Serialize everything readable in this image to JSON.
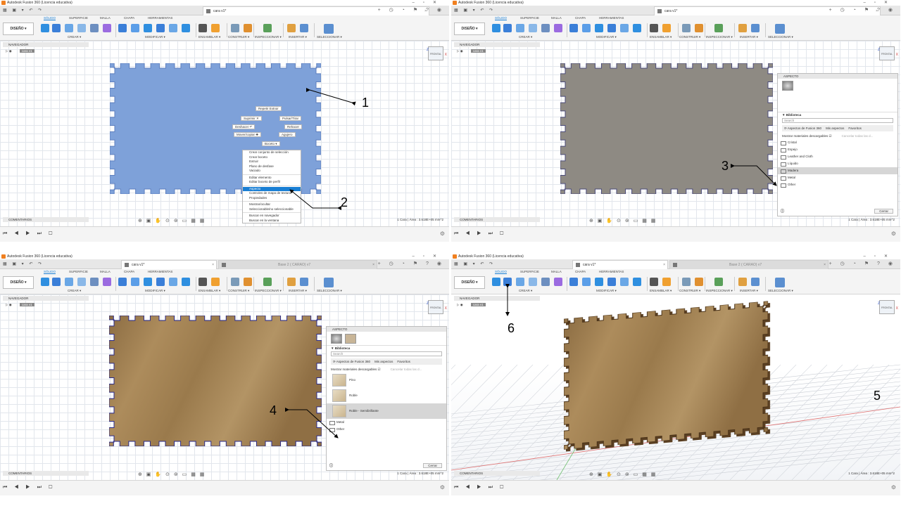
{
  "app": {
    "title": "Autodesk Fusion 360 (Licencia educativa)",
    "workspace": "DISEÑO",
    "ribbon_tabs": [
      "SÓLIDO",
      "SUPERFICIE",
      "MALLA",
      "CHAPA",
      "HERRAMIENTAS"
    ],
    "groups": [
      "CREAR",
      "MODIFICAR",
      "ENSAMBLAR",
      "CONSTRUIR",
      "INSPECCIONAR",
      "INSERTAR",
      "SELECCIONAR"
    ],
    "navigator": "NAVEGADOR",
    "component": "cara v1",
    "comments": "COMENTARIOS",
    "status": "1 Cara | Área : 3.618E+05 mm^2",
    "doc_tab": "cara v1*",
    "doc_tab2": "Base 2 ( CARAO) v7",
    "viewcube": "FRONTAL",
    "axis_z": "Z",
    "axis_x": "X"
  },
  "marking_menu": {
    "repeat": "Repetir Extruir",
    "delete": "Suprimir",
    "press_pull": "Pulsar/Tirar",
    "undo": "Deshacer",
    "redo": "Rehacer",
    "move_copy": "Mover/copiar",
    "holes": "Agujero",
    "sketch": "Boceto"
  },
  "context_menu": [
    "Crear conjunto de selección",
    "Crear boceto",
    "Extruir",
    "Plano de desfase",
    "Vaciado",
    "Editar elemento",
    "Editar boceto de perfil",
    "Aspecto",
    "Controles de mapa de textura",
    "Propiedades",
    "Mostrar/ocultar",
    "Seleccionable/no seleccionable",
    "Buscar en navegador",
    "Buscar en la ventana"
  ],
  "appearance_panel": {
    "title": "ASPECTO",
    "library": "Biblioteca",
    "search": "Search",
    "lib_fusion": "Aspectos de Fusion 360",
    "lib_mine": "Mis aspectos",
    "lib_fav": "Favoritos",
    "show_downloadable": "Mostrar materiales descargables",
    "cancel_all": "Cancelar todas las d...",
    "folders": [
      "Cristal",
      "Espejo",
      "Leather and Cloth",
      "Líquido",
      "Madera",
      "Metal",
      "Other"
    ],
    "wood_items": [
      "Pino",
      "Roble",
      "Roble - Semibrillante"
    ],
    "bottom_folders": [
      "Metal",
      "Other"
    ],
    "close": "Cerrar"
  },
  "annotations": [
    "1",
    "2",
    "3",
    "4",
    "5",
    "6"
  ],
  "colors": {
    "plate_blue": "#7ea1d9",
    "plate_gray": "#8e8a83",
    "wood": "#a0804f",
    "accent": "#1a7fd4"
  }
}
